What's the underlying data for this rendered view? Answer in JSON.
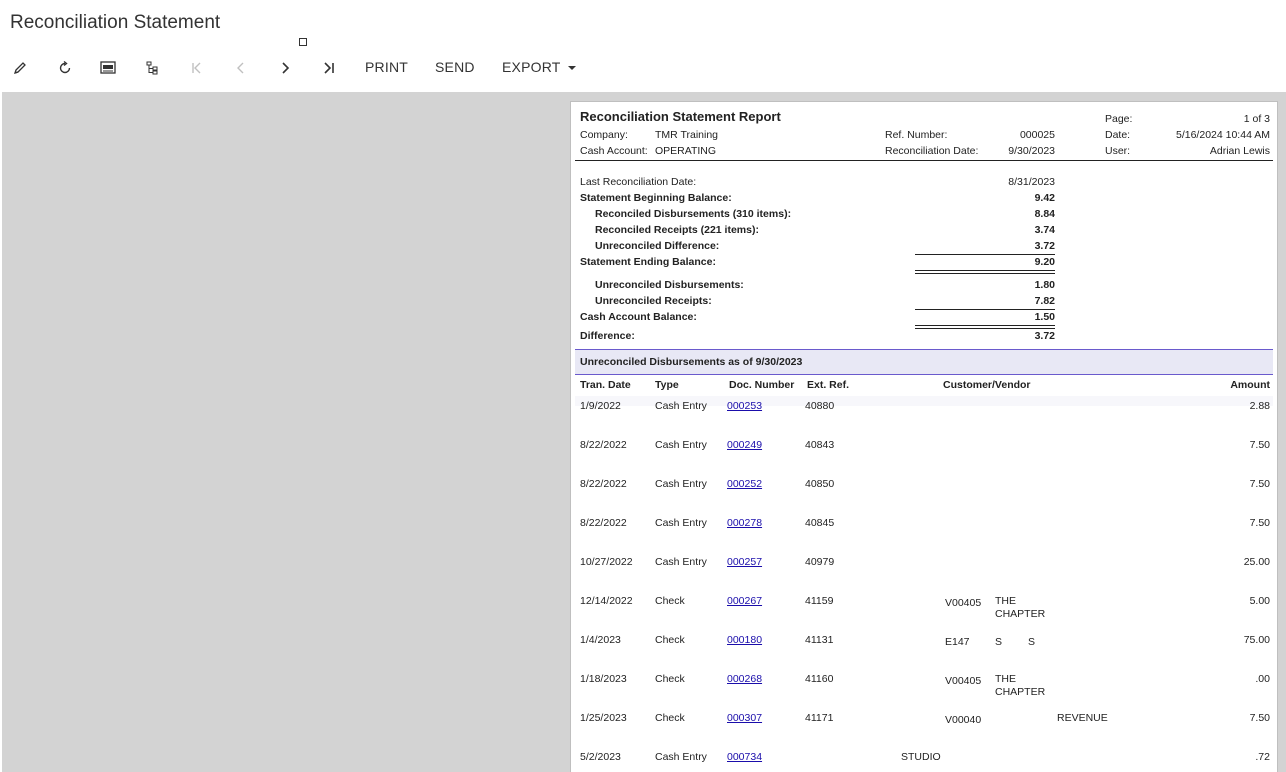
{
  "page": {
    "title": "Reconciliation Statement"
  },
  "toolbar": {
    "print_label": "PRINT",
    "send_label": "SEND",
    "export_label": "EXPORT"
  },
  "report": {
    "title": "Reconciliation Statement Report",
    "company_label": "Company:",
    "company_value": "TMR Training",
    "cash_account_label": "Cash Account:",
    "cash_account_value": "OPERATING",
    "ref_number_label": "Ref. Number:",
    "ref_number_value": "000025",
    "recon_date_label": "Reconciliation Date:",
    "recon_date_value": "9/30/2023",
    "page_label": "Page:",
    "page_value": "1 of 3",
    "date_label": "Date:",
    "date_value": "5/16/2024 10:44 AM",
    "user_label": "User:",
    "user_value": "Adrian Lewis",
    "summary": [
      {
        "label": "Last Reconciliation Date:",
        "value": "8/31/2023",
        "bold": false,
        "indent": false
      },
      {
        "label": "Statement Beginning Balance:",
        "value": "9.42",
        "bold": true,
        "indent": false
      },
      {
        "label": "Reconciled Disbursements (310 items):",
        "value": "8.84",
        "bold": true,
        "indent": true
      },
      {
        "label": "Reconciled Receipts (221 items):",
        "value": "3.74",
        "bold": true,
        "indent": true
      },
      {
        "label": "Unreconciled Difference:",
        "value": "3.72",
        "bold": true,
        "indent": true
      },
      {
        "label": "Statement Ending Balance:",
        "value": "9.20",
        "bold": true,
        "indent": false
      },
      {
        "label": "Unreconciled Disbursements:",
        "value": "1.80",
        "bold": true,
        "indent": true
      },
      {
        "label": "Unreconciled Receipts:",
        "value": "7.82",
        "bold": true,
        "indent": true
      },
      {
        "label": "Cash Account Balance:",
        "value": "1.50",
        "bold": true,
        "indent": false
      },
      {
        "label": "Difference:",
        "value": "3.72",
        "bold": true,
        "indent": false
      }
    ],
    "section_title": "Unreconciled Disbursements as of 9/30/2023",
    "columns": {
      "tran_date": "Tran. Date",
      "type": "Type",
      "doc_number": "Doc. Number",
      "ext_ref": "Ext. Ref.",
      "customer_vendor": "Customer/Vendor",
      "amount": "Amount"
    },
    "rows": [
      {
        "date": "1/9/2022",
        "type": "Cash Entry",
        "doc": "000253",
        "ext": "40880",
        "vendor_id": "",
        "vendor_name": "",
        "vendor_extra": "",
        "amount": "2.88"
      },
      {
        "date": "8/22/2022",
        "type": "Cash Entry",
        "doc": "000249",
        "ext": "40843",
        "vendor_id": "",
        "vendor_name": "",
        "vendor_extra": "",
        "amount": "7.50"
      },
      {
        "date": "8/22/2022",
        "type": "Cash Entry",
        "doc": "000252",
        "ext": "40850",
        "vendor_id": "",
        "vendor_name": "",
        "vendor_extra": "",
        "amount": "7.50"
      },
      {
        "date": "8/22/2022",
        "type": "Cash Entry",
        "doc": "000278",
        "ext": "40845",
        "vendor_id": "",
        "vendor_name": "",
        "vendor_extra": "",
        "amount": "7.50"
      },
      {
        "date": "10/27/2022",
        "type": "Cash Entry",
        "doc": "000257",
        "ext": "40979",
        "vendor_id": "",
        "vendor_name": "",
        "vendor_extra": "",
        "amount": "25.00"
      },
      {
        "date": "12/14/2022",
        "type": "Check",
        "doc": "000267",
        "ext": "41159",
        "vendor_id": "V00405",
        "vendor_name": "THE CHAPTER",
        "vendor_extra": "",
        "amount": "5.00"
      },
      {
        "date": "1/4/2023",
        "type": "Check",
        "doc": "000180",
        "ext": "41131",
        "vendor_id": "E147",
        "vendor_name": "S",
        "vendor_extra": "S",
        "amount": "75.00"
      },
      {
        "date": "1/18/2023",
        "type": "Check",
        "doc": "000268",
        "ext": "41160",
        "vendor_id": "V00405",
        "vendor_name": "THE CHAPTER",
        "vendor_extra": "",
        "amount": ".00"
      },
      {
        "date": "1/25/2023",
        "type": "Check",
        "doc": "000307",
        "ext": "41171",
        "vendor_id": "V00040",
        "vendor_name": "",
        "vendor_extra": "REVENUE",
        "amount": "7.50"
      },
      {
        "date": "5/2/2023",
        "type": "Cash Entry",
        "doc": "000734",
        "ext": "",
        "vendor_id": "",
        "vendor_name": "STUDIO",
        "vendor_extra": "",
        "amount": ".72"
      }
    ]
  }
}
